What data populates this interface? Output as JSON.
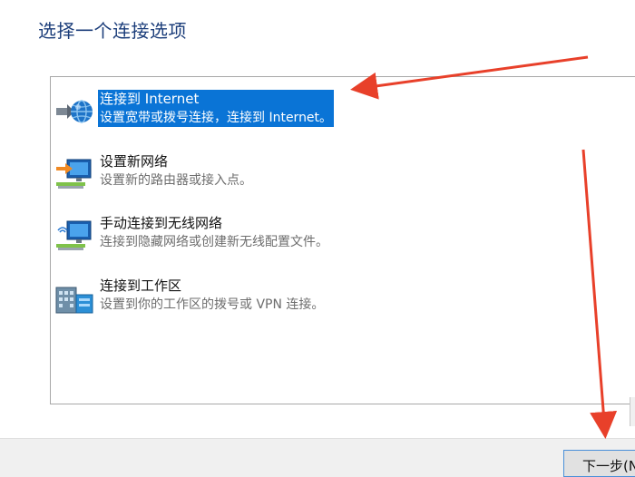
{
  "page": {
    "title": "选择一个连接选项"
  },
  "options": [
    {
      "title": "连接到 Internet",
      "desc": "设置宽带或拨号连接，连接到 Internet。",
      "icon": "globe-network-icon",
      "selected": true
    },
    {
      "title": "设置新网络",
      "desc": "设置新的路由器或接入点。",
      "icon": "new-network-icon",
      "selected": false
    },
    {
      "title": "手动连接到无线网络",
      "desc": "连接到隐藏网络或创建新无线配置文件。",
      "icon": "wireless-network-icon",
      "selected": false
    },
    {
      "title": "连接到工作区",
      "desc": "设置到你的工作区的拨号或 VPN 连接。",
      "icon": "workplace-icon",
      "selected": false
    }
  ],
  "footer": {
    "next_label": "下一步(N)"
  },
  "colors": {
    "heading": "#1b3d7a",
    "selection": "#0a74d6",
    "annotation_arrow": "#e8402a"
  }
}
